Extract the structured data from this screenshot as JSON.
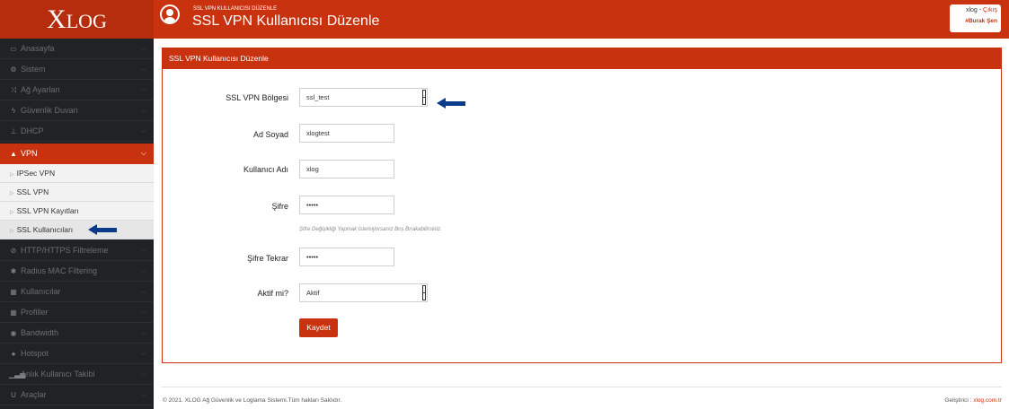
{
  "app": {
    "logo_x": "X",
    "logo_rest": "LOG",
    "subtitle": "SSL VPN KULLANICISI DÜZENLE",
    "title": "SSL VPN Kullanıcısı Düzenle"
  },
  "user": {
    "name": "xlog",
    "separator": " - ",
    "logout": "Çıkış",
    "full_name": "#Burak Şen"
  },
  "sidebar": {
    "items": [
      {
        "label": "Anasayfa",
        "icon": "laptop-icon"
      },
      {
        "label": "Sistem",
        "icon": "cogs-icon"
      },
      {
        "label": "Ağ Ayarları",
        "icon": "random-icon"
      },
      {
        "label": "Güvenlik Duvarı",
        "icon": "bolt-icon"
      },
      {
        "label": "DHCP",
        "icon": "sitemap-icon"
      },
      {
        "label": "VPN",
        "icon": "road-icon"
      },
      {
        "label": "HTTP/HTTPS Filtreleme",
        "icon": "eye-slash-icon"
      },
      {
        "label": "Radius MAC Filtering",
        "icon": "asterisk-icon"
      },
      {
        "label": "Kullanıcılar",
        "icon": "users-grid-icon"
      },
      {
        "label": "Profiller",
        "icon": "profiles-grid-icon"
      },
      {
        "label": "Bandwidth",
        "icon": "car-icon"
      },
      {
        "label": "Hotspot",
        "icon": "globe-icon"
      },
      {
        "label": "Anlık Kullanıcı Takibi",
        "icon": "signal-icon"
      },
      {
        "label": "Araçlar",
        "icon": "magnet-icon"
      }
    ],
    "vpn_sub": [
      {
        "label": "IPSec VPN"
      },
      {
        "label": "SSL VPN"
      },
      {
        "label": "SSL VPN Kayıtları"
      },
      {
        "label": "SSL Kullanıcıları"
      }
    ]
  },
  "panel": {
    "title": "SSL VPN Kullanıcısı Düzenle"
  },
  "form": {
    "region_label": "SSL VPN Bölgesi",
    "region_value": "ssl_test",
    "name_label": "Ad Soyad",
    "name_value": "xlogtest",
    "username_label": "Kullanıcı Adı",
    "username_value": "xlog",
    "password_label": "Şifre",
    "password_value": "•••••",
    "password_hint": "Şifre Değişikliği Yapmak İstemiyorsanız Boş Bırakabilirsiniz.",
    "password2_label": "Şifre Tekrar",
    "password2_value": "•••••",
    "active_label": "Aktif mi?",
    "active_value": "Aktif",
    "save_label": "Kaydet"
  },
  "footer": {
    "copyright": "© 2021. XLOG Ağ Güvenlik ve Loglama Sistemi.Tüm hakları Saklıdır.",
    "dev_prefix": "Geliştirici : ",
    "dev_link": "xlog.com.tr"
  },
  "colors": {
    "brand": "#c9320f",
    "sidebar_bg": "#1f2325",
    "annotation_arrow": "#0b3a8a"
  }
}
